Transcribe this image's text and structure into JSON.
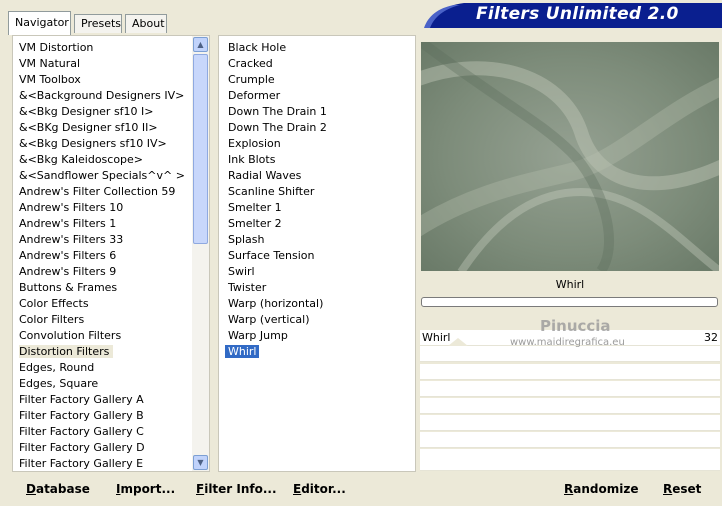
{
  "tabs": [
    {
      "label": "Navigator"
    },
    {
      "label": "Presets"
    },
    {
      "label": "About"
    }
  ],
  "app_title": "Filters Unlimited 2.0",
  "categories": {
    "items": [
      "VM Distortion",
      "VM Natural",
      "VM Toolbox",
      "&<Background Designers IV>",
      "&<Bkg Designer sf10 I>",
      "&<BKg Designer sf10 II>",
      "&<Bkg Designers sf10 IV>",
      "&<Bkg Kaleidoscope>",
      "&<Sandflower Specials^v^ >",
      "Andrew's Filter Collection 59",
      "Andrew's Filters 10",
      "Andrew's Filters 1",
      "Andrew's Filters 33",
      "Andrew's Filters 6",
      "Andrew's Filters 9",
      "Buttons & Frames",
      "Color Effects",
      "Color Filters",
      "Convolution Filters",
      "Distortion Filters",
      "Edges, Round",
      "Edges, Square",
      "Filter Factory Gallery A",
      "Filter Factory Gallery B",
      "Filter Factory Gallery C",
      "Filter Factory Gallery D",
      "Filter Factory Gallery E"
    ],
    "selected": "Distortion Filters"
  },
  "filters": {
    "items": [
      "Black Hole",
      "Cracked",
      "Crumple",
      "Deformer",
      "Down The Drain 1",
      "Down The Drain 2",
      "Explosion",
      "Ink Blots",
      "Radial Waves",
      "Scanline Shifter",
      "Smelter 1",
      "Smelter 2",
      "Splash",
      "Surface Tension",
      "Swirl",
      "Twister",
      "Warp (horizontal)",
      "Warp (vertical)",
      "Warp Jump",
      "Whirl"
    ],
    "selected": "Whirl"
  },
  "preview": {
    "filter_name": "Whirl"
  },
  "parameters": [
    {
      "name": "Whirl",
      "value": "32"
    }
  ],
  "watermark": {
    "line1": "Pinuccia",
    "line2": "www.maidiregrafica.eu"
  },
  "buttons": {
    "database": "Database",
    "import": "Import...",
    "filter_info": "Filter Info...",
    "editor": "Editor...",
    "randomize": "Randomize",
    "reset": "Reset"
  },
  "colors": {
    "banner_blue": "#0a1f8f",
    "selection_blue": "#316ac5",
    "preview_green": "#8a9a88"
  }
}
